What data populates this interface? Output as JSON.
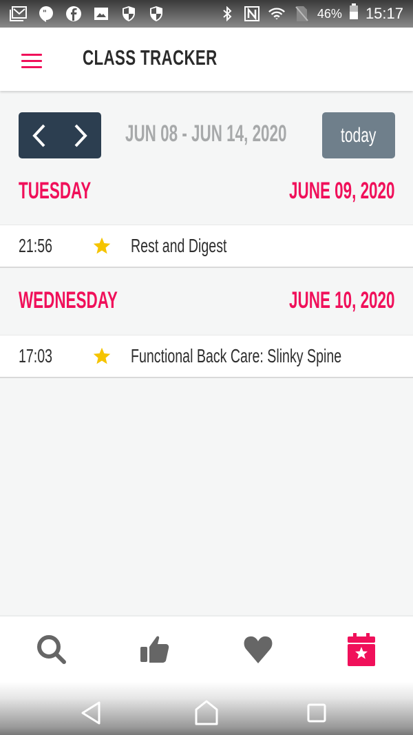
{
  "status_bar": {
    "left_icons": [
      "gmail-icon",
      "hangouts-icon",
      "facebook-icon",
      "gallery-icon",
      "shield-icon",
      "shield-icon"
    ],
    "right_icons": [
      "bluetooth-icon",
      "nfc-icon",
      "wifi-icon",
      "no-sim-icon"
    ],
    "battery_percent": "46%",
    "time": "15:17"
  },
  "app_bar": {
    "menu_icon": "hamburger-icon",
    "title": "CLASS TRACKER"
  },
  "week_nav": {
    "prev_icon": "chevron-left-icon",
    "next_icon": "chevron-right-icon",
    "range": "JUN 08 - JUN 14, 2020",
    "today_label": "today"
  },
  "days": [
    {
      "weekday": "TUESDAY",
      "date": "JUNE 09, 2020",
      "classes": [
        {
          "time": "21:56",
          "icon": "star-icon",
          "title": "Rest and Digest"
        }
      ]
    },
    {
      "weekday": "WEDNESDAY",
      "date": "JUNE 10, 2020",
      "classes": [
        {
          "time": "17:03",
          "icon": "star-icon",
          "title": "Functional Back Care: Slinky Spine"
        }
      ]
    }
  ],
  "tab_bar": {
    "tabs": [
      {
        "name": "search",
        "icon": "search-icon",
        "active": false
      },
      {
        "name": "recommended",
        "icon": "thumbs-up-icon",
        "active": false
      },
      {
        "name": "favorites",
        "icon": "heart-icon",
        "active": false
      },
      {
        "name": "class-tracker",
        "icon": "calendar-star-icon",
        "active": true
      }
    ]
  },
  "colors": {
    "accent": "#f0105a",
    "nav_dark": "#2c3e50",
    "today_button": "#6f7f8b",
    "star": "#f5c400",
    "icon_inactive": "#666666"
  },
  "system_nav": [
    "back-icon",
    "home-icon",
    "recents-icon"
  ]
}
